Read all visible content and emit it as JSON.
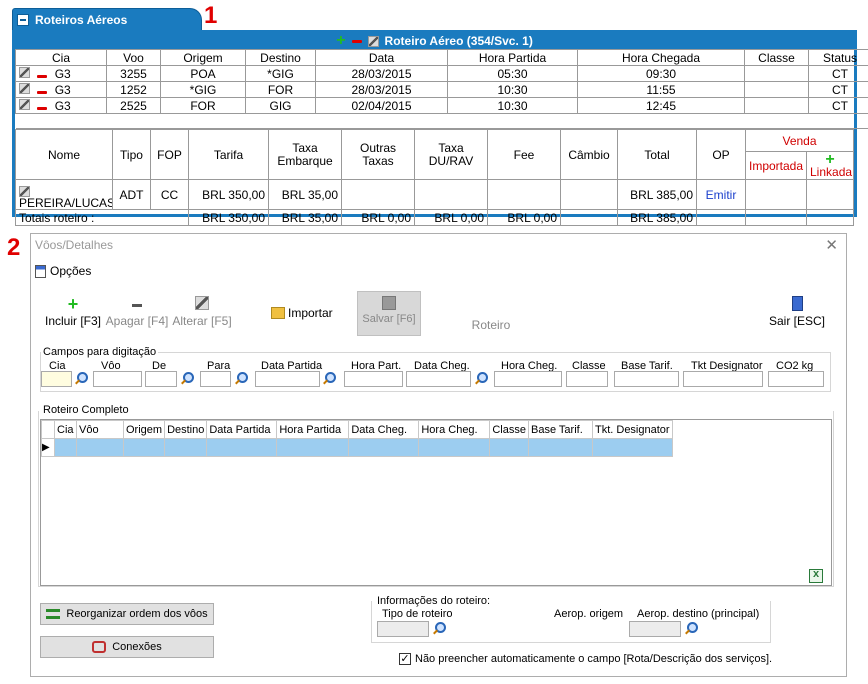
{
  "markers": [
    "1",
    "2"
  ],
  "panel1": {
    "tab_title": "Roteiros Aéreos",
    "route_title": "Roteiro Aéreo (354/Svc. 1)",
    "flight_headers": [
      "Cia",
      "Voo",
      "Origem",
      "Destino",
      "Data",
      "Hora Partida",
      "Hora Chegada",
      "Classe",
      "Status"
    ],
    "flights": [
      {
        "cia": "G3",
        "voo": "3255",
        "origem": "POA",
        "destino": "*GIG",
        "data": "28/03/2015",
        "hora_partida": "05:30",
        "hora_chegada": "09:30",
        "classe": "",
        "status": "CT"
      },
      {
        "cia": "G3",
        "voo": "1252",
        "origem": "*GIG",
        "destino": "FOR",
        "data": "28/03/2015",
        "hora_partida": "10:30",
        "hora_chegada": "11:55",
        "classe": "",
        "status": "CT"
      },
      {
        "cia": "G3",
        "voo": "2525",
        "origem": "FOR",
        "destino": "GIG",
        "data": "02/04/2015",
        "hora_partida": "10:30",
        "hora_chegada": "12:45",
        "classe": "",
        "status": "CT"
      }
    ],
    "pax_headers": {
      "nome": "Nome",
      "tipo": "Tipo",
      "fop": "FOP",
      "tarifa": "Tarifa",
      "taxa_embarque": "Taxa Embarque",
      "outras_taxas": "Outras Taxas",
      "taxa_du_rav": "Taxa DU/RAV",
      "fee": "Fee",
      "cambio": "Câmbio",
      "total": "Total",
      "op": "OP",
      "venda": "Venda",
      "importada": "Importada",
      "linkada": "Linkada"
    },
    "pax": {
      "nome": "PEREIRA/LUCAS",
      "tipo": "ADT",
      "fop": "CC",
      "tarifa": "BRL 350,00",
      "taxa_embarque": "BRL 35,00",
      "outras_taxas": "",
      "taxa_du_rav": "",
      "fee": "",
      "cambio": "",
      "total": "BRL 385,00",
      "op": "Emitir"
    },
    "totals": {
      "label": "Totais roteiro :",
      "tarifa": "BRL 350,00",
      "taxa_embarque": "BRL 35,00",
      "outras_taxas": "BRL 0,00",
      "taxa_du_rav": "BRL 0,00",
      "fee": "BRL 0,00",
      "total": "BRL 385,00"
    },
    "colors": {
      "accent": "#1a7bbf",
      "red": "#d00000",
      "green": "#22bb22",
      "link": "#1a3fcc"
    }
  },
  "dialog": {
    "title": "Vôos/Detalhes",
    "menu_opcoes": "Opções",
    "toolbar": {
      "incluir": "Incluir [F3]",
      "apagar": "Apagar [F4]",
      "alterar": "Alterar [F5]",
      "importar": "Importar",
      "salvar": "Salvar [F6]",
      "roteiro": "Roteiro",
      "sair": "Sair [ESC]"
    },
    "campos_legend": "Campos para digitação",
    "campos": {
      "cia": "Cia",
      "voo": "Vôo",
      "de": "De",
      "para": "Para",
      "data_partida": "Data Partida",
      "hora_part": "Hora Part.",
      "data_cheg": "Data Cheg.",
      "hora_cheg": "Hora Cheg.",
      "classe": "Classe",
      "base_tarif": "Base Tarif.",
      "tkt_designator": "Tkt Designator",
      "co2": "CO2 kg"
    },
    "roteiro_legend": "Roteiro Completo",
    "roteiro_headers": [
      "Cia",
      "Vôo",
      "Origem",
      "Destino",
      "Data Partida",
      "Hora Partida",
      "Data Cheg.",
      "Hora Cheg.",
      "Classe",
      "Base Tarif.",
      "Tkt. Designator"
    ],
    "btn_reorganizar": "Reorganizar ordem dos vôos",
    "btn_conexoes": "Conexões",
    "info_legend": "Informações do roteiro:",
    "tipo_roteiro": "Tipo de roteiro",
    "aerop_origem": "Aerop. origem",
    "aerop_destino": "Aerop. destino (principal)",
    "checkbox_label": "Não preencher automaticamente o campo [Rota/Descrição dos serviços].",
    "checkbox_checked": true
  }
}
